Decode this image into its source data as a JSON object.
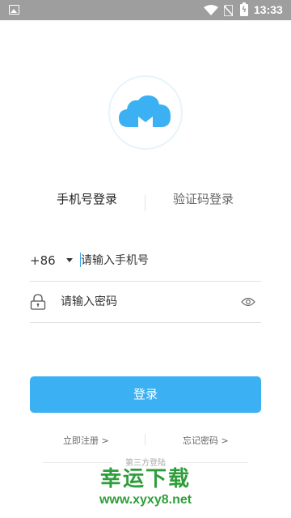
{
  "status_bar": {
    "time": "13:33",
    "icons": [
      "image-icon",
      "wifi-icon",
      "sim-off-icon",
      "battery-charging-icon"
    ]
  },
  "logo": {
    "icon": "cloud-logo-icon",
    "color": "#3bb1f4"
  },
  "tabs": [
    {
      "label": "手机号登录",
      "active": true
    },
    {
      "label": "验证码登录",
      "active": false
    }
  ],
  "phone_row": {
    "country_code": "+86",
    "placeholder": "请输入手机号",
    "value": ""
  },
  "password_row": {
    "icon": "lock-icon",
    "placeholder": "请输入密码",
    "value": "",
    "toggle_icon": "eye-icon"
  },
  "login_button": {
    "label": "登录",
    "color": "#3bb1f4"
  },
  "links": {
    "register": "立即注册 >",
    "forgot": "忘记密码 >"
  },
  "third_party_label": "第三方登陆",
  "watermark": {
    "text": "幸运下载",
    "url": "www.xyxy8.net",
    "color": "#2e9e3a"
  }
}
